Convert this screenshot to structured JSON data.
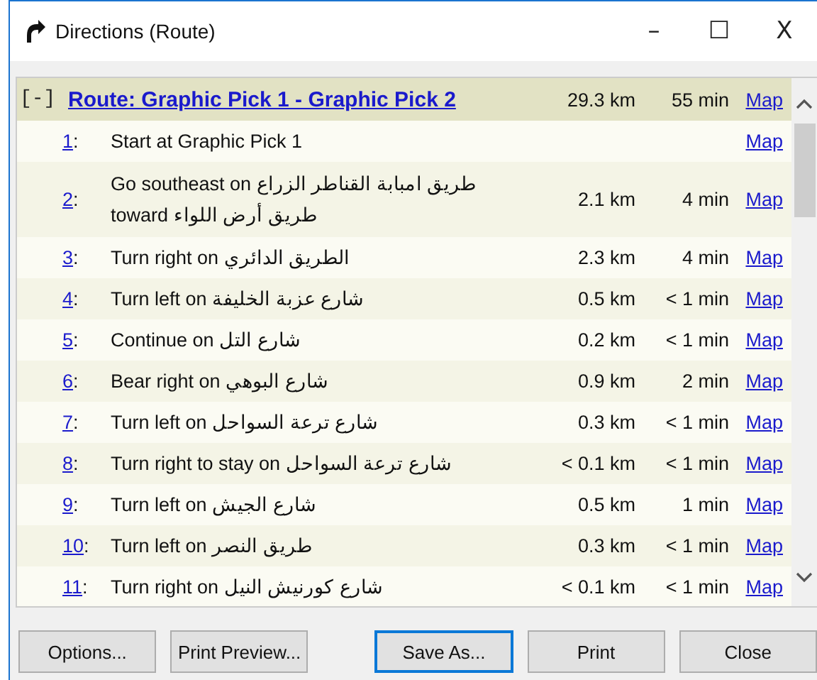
{
  "window": {
    "title": "Directions (Route)",
    "controls": [
      "–",
      "☐",
      "X"
    ]
  },
  "step_separator": ":",
  "route": {
    "toggle": "[-]",
    "name": "Route: Graphic Pick 1 - Graphic Pick 2",
    "distance": "29.3 km",
    "time": "55 min",
    "map": "Map"
  },
  "steps": [
    {
      "number": "1",
      "text": "Start at Graphic Pick 1",
      "map": "Map"
    },
    {
      "number": "2",
      "text": "Go southeast on طريق امبابة القناطر الزراع toward طريق أرض اللواء",
      "distance": "2.1 km",
      "time": "4 min",
      "map": "Map"
    },
    {
      "number": "3",
      "text": "Turn right on الطريق الدائري",
      "distance": "2.3 km",
      "time": "4 min",
      "map": "Map"
    },
    {
      "number": "4",
      "text": "Turn left on شارع عزبة الخليفة",
      "distance": "0.5 km",
      "time": "< 1 min",
      "map": "Map"
    },
    {
      "number": "5",
      "text": "Continue on شارع التل",
      "distance": "0.2 km",
      "time": "< 1 min",
      "map": "Map"
    },
    {
      "number": "6",
      "text": "Bear right on شارع البوهي",
      "distance": "0.9 km",
      "time": "2 min",
      "map": "Map"
    },
    {
      "number": "7",
      "text": "Turn left on شارع ترعة السواحل",
      "distance": "0.3 km",
      "time": "< 1 min",
      "map": "Map"
    },
    {
      "number": "8",
      "text": "Turn right to stay on شارع ترعة السواحل",
      "distance": "< 0.1 km",
      "time": "< 1 min",
      "map": "Map"
    },
    {
      "number": "9",
      "text": "Turn left on شارع الجيش",
      "distance": "0.5 km",
      "time": "1 min",
      "map": "Map"
    },
    {
      "number": "10",
      "text": "Turn left on طريق النصر",
      "distance": "0.3 km",
      "time": "< 1 min",
      "map": "Map"
    },
    {
      "number": "11",
      "text": "Turn right on شارع كورنيش النيل",
      "distance": "< 0.1 km",
      "time": "< 1 min",
      "map": "Map"
    }
  ],
  "buttons": [
    {
      "label": "Options...",
      "selected": false
    },
    {
      "label": "Print Preview...",
      "selected": false
    },
    {
      "label": "Save As...",
      "selected": true
    },
    {
      "label": "Print",
      "selected": false
    },
    {
      "label": "Close",
      "selected": false
    }
  ]
}
